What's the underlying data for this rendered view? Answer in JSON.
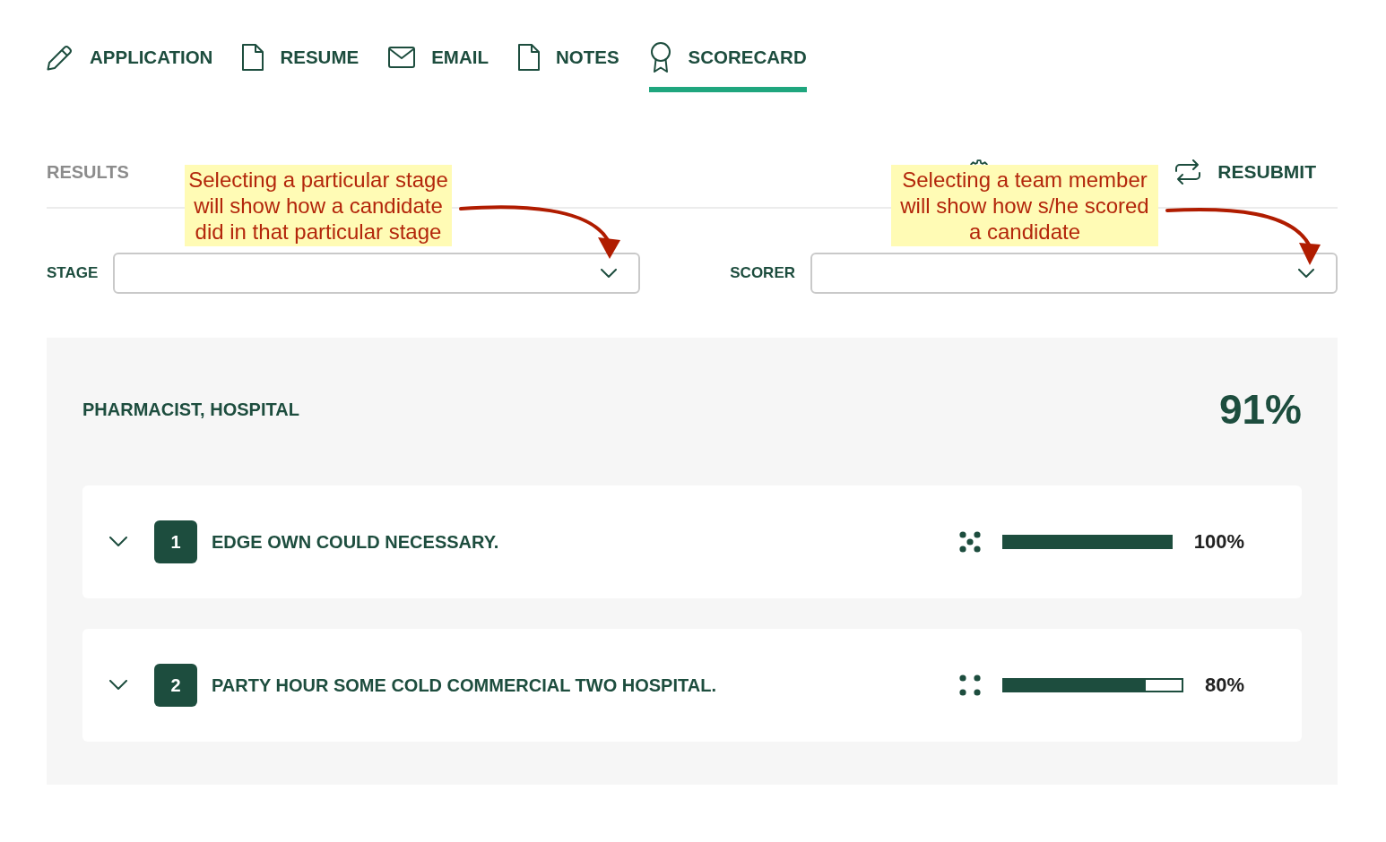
{
  "tabs": [
    {
      "kind": "application",
      "label": "APPLICATION",
      "selected": false
    },
    {
      "kind": "resume",
      "label": "RESUME",
      "selected": false
    },
    {
      "kind": "email",
      "label": "EMAIL",
      "selected": false
    },
    {
      "kind": "notes",
      "label": "NOTES",
      "selected": false
    },
    {
      "kind": "scorecard",
      "label": "SCORECARD",
      "selected": true
    }
  ],
  "results_bar": {
    "title": "RESULTS",
    "actions": [
      {
        "kind": "settings"
      },
      {
        "kind": "resubmit",
        "label": "RESUBMIT"
      }
    ]
  },
  "filters": [
    {
      "label": "STAGE",
      "callout": "Selecting a particular stage will show how a candidate did in that particular stage"
    },
    {
      "label": "SCORER",
      "callout": "Selecting a team member will show how s/he scored a candidate"
    }
  ],
  "panel": {
    "title": "PHARMACIST, HOSPITAL",
    "score": "91%",
    "criteria": [
      {
        "kind": "five-dots",
        "number": "1",
        "title": "EDGE OWN COULD NECESSARY.",
        "expanded": false,
        "level": 1.0,
        "reading": "100%"
      },
      {
        "kind": "four-dots",
        "number": "2",
        "title": "PARTY HOUR SOME COLD COMMERCIAL TWO HOSPITAL.",
        "expanded": false,
        "level": 0.8,
        "reading": "80%"
      }
    ]
  }
}
